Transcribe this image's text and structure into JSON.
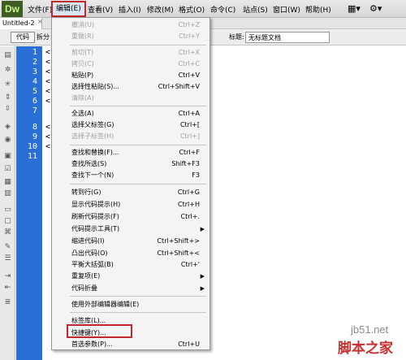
{
  "app": {
    "logo_text": "Dw"
  },
  "menubar": {
    "items": [
      "文件(F)",
      "编辑(E)",
      "查看(V)",
      "插入(I)",
      "修改(M)",
      "格式(O)",
      "命令(C)",
      "站点(S)",
      "窗口(W)",
      "帮助(H)"
    ],
    "active": "编辑(E)"
  },
  "tab": {
    "name": "Untitled-2",
    "close": "×"
  },
  "doc_toolbar": {
    "code_button": "代码",
    "split_button": "拆分",
    "title_label": "标题:",
    "title_value": "无标题文档"
  },
  "gutter": {
    "line_numbers": [
      "1",
      "2",
      "3",
      "4",
      "5",
      "6",
      "7",
      "8",
      "9",
      "10",
      "11"
    ]
  },
  "code": {
    "lines": [
      "<",
      "<",
      "<",
      "<",
      "<",
      "<",
      "",
      "<",
      "<",
      "<",
      ""
    ]
  },
  "edit_menu": {
    "items": [
      {
        "label": "撤消(U)",
        "shortcut": "Ctrl+Z",
        "disabled": true
      },
      {
        "label": "重做(R)",
        "shortcut": "Ctrl+Y",
        "disabled": true
      },
      {
        "label": "剪切(T)",
        "shortcut": "Ctrl+X",
        "disabled": true
      },
      {
        "label": "拷贝(C)",
        "shortcut": "Ctrl+C",
        "disabled": true
      },
      {
        "label": "粘贴(P)",
        "shortcut": "Ctrl+V",
        "disabled": false
      },
      {
        "label": "选择性粘贴(S)...",
        "shortcut": "Ctrl+Shift+V",
        "disabled": false
      },
      {
        "label": "清除(A)",
        "shortcut": "",
        "disabled": true
      },
      {
        "label": "全选(A)",
        "shortcut": "Ctrl+A",
        "disabled": false
      },
      {
        "label": "选择父标签(G)",
        "shortcut": "Ctrl+[",
        "disabled": false
      },
      {
        "label": "选择子标签(H)",
        "shortcut": "Ctrl+]",
        "disabled": true
      },
      {
        "label": "查找和替换(F)...",
        "shortcut": "Ctrl+F",
        "disabled": false
      },
      {
        "label": "查找所选(S)",
        "shortcut": "Shift+F3",
        "disabled": false
      },
      {
        "label": "查找下一个(N)",
        "shortcut": "F3",
        "disabled": false
      },
      {
        "label": "转到行(G)",
        "shortcut": "Ctrl+G",
        "disabled": false
      },
      {
        "label": "显示代码提示(H)",
        "shortcut": "Ctrl+H",
        "disabled": false
      },
      {
        "label": "刷新代码提示(F)",
        "shortcut": "Ctrl+.",
        "disabled": false
      },
      {
        "label": "代码提示工具(T)",
        "shortcut": "",
        "disabled": false,
        "submenu": true
      },
      {
        "label": "缩进代码(I)",
        "shortcut": "Ctrl+Shift+>",
        "disabled": false
      },
      {
        "label": "凸出代码(O)",
        "shortcut": "Ctrl+Shift+<",
        "disabled": false
      },
      {
        "label": "平衡大括弧(B)",
        "shortcut": "Ctrl+'",
        "disabled": false
      },
      {
        "label": "重复项(E)",
        "shortcut": "",
        "disabled": false,
        "submenu": true
      },
      {
        "label": "代码折叠",
        "shortcut": "",
        "disabled": false,
        "submenu": true
      },
      {
        "label": "使用外部编辑器编辑(E)",
        "shortcut": "",
        "disabled": false
      },
      {
        "label": "标签库(L)...",
        "shortcut": "",
        "disabled": false
      },
      {
        "label": "快捷键(Y)...",
        "shortcut": "",
        "disabled": false,
        "highlighted": true
      },
      {
        "label": "首选参数(P)...",
        "shortcut": "Ctrl+U",
        "disabled": false
      }
    ],
    "submenu_arrow": "▶"
  },
  "watermark": {
    "site": "jb51.net",
    "name": "脚本之家"
  },
  "colors": {
    "accent_red": "#c0282d",
    "gutter_blue": "#2a6fd6",
    "logo_green": "#3d5d22"
  },
  "icons": [
    "layout-icon",
    "settings-gear-icon"
  ]
}
